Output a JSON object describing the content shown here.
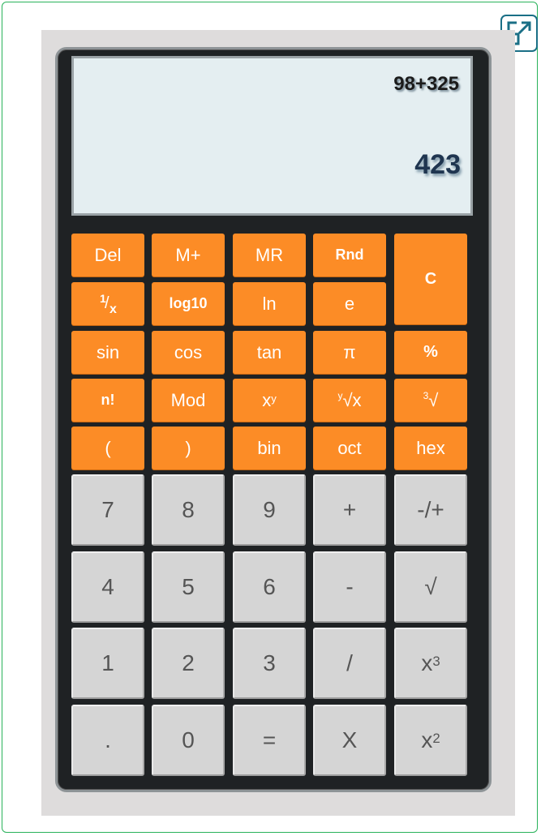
{
  "display": {
    "expression": "98+325",
    "result": "423"
  },
  "icons": {
    "expand": "expand-icon"
  },
  "buttons": {
    "del": "Del",
    "mplus": "M+",
    "mr": "MR",
    "rnd": "Rnd",
    "clear": "C",
    "reciprocal_num": "1",
    "reciprocal_den": "x",
    "log10": "log10",
    "ln": "ln",
    "e": "e",
    "sin": "sin",
    "cos": "cos",
    "tan": "tan",
    "pi": "π",
    "percent": "%",
    "factorial": "n!",
    "mod": "Mod",
    "power_base": "x",
    "power_exp": "y",
    "yroot_index": "y",
    "yroot_body": "√x",
    "cuberoot_index": "3",
    "cuberoot_body": "√",
    "lparen": "(",
    "rparen": ")",
    "bin": "bin",
    "oct": "oct",
    "hex": "hex",
    "seven": "7",
    "eight": "8",
    "nine": "9",
    "plus": "+",
    "negate": "-/+",
    "four": "4",
    "five": "5",
    "six": "6",
    "minus": "-",
    "sqrt": "√",
    "one": "1",
    "two": "2",
    "three": "3",
    "divide": "/",
    "cube_base": "x",
    "cube_exp": "3",
    "dot": ".",
    "zero": "0",
    "equals": "=",
    "multiply": "X",
    "square_base": "x",
    "square_exp": "2"
  },
  "colors": {
    "function_key": "#fc8c26",
    "number_key": "#d5d5d5",
    "body": "#1f2224",
    "screen": "#e4eef1",
    "frame_border": "#29b25a"
  }
}
